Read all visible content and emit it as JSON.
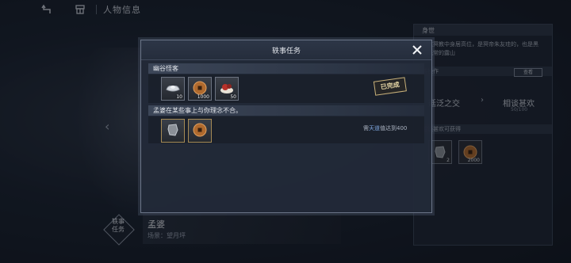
{
  "topbar": {
    "title": "人物信息"
  },
  "right_panel": {
    "head": "身世",
    "desc": "在玄冥教中身居高位，是冥帝朱友珪的，也是黑白无常的露山",
    "head2": "转操作",
    "button": "查看",
    "option1": "廷泛之交",
    "option2": "相谈甚欢",
    "progress": "50/100",
    "head3": "相谈甚欢可获得",
    "items": [
      {
        "count": "2"
      },
      {
        "count": "2000"
      }
    ]
  },
  "character": {
    "badge_line1": "轶事",
    "badge_line2": "任务",
    "name": "孟婆",
    "scene": "场景：望月坪"
  },
  "modal": {
    "title": "轶事任务",
    "section1": {
      "title": "幽谷怪客",
      "items": [
        {
          "icon": "silver-ingot-icon",
          "count": "10"
        },
        {
          "icon": "copper-coin-icon",
          "count": "1000"
        },
        {
          "icon": "food-icon",
          "count": "50"
        }
      ],
      "stamp": "已完成"
    },
    "section2": {
      "title": "孟婆在某些事上与你理念不合。",
      "items": [
        {
          "icon": "stone-icon",
          "count": ""
        },
        {
          "icon": "copper-coin-icon",
          "count": ""
        }
      ],
      "req_prefix": "需",
      "req_highlight": "天道",
      "req_suffix": "值达到400"
    }
  },
  "colors": {
    "accent": "#7fa7e0",
    "stamp": "#c7b07a"
  }
}
